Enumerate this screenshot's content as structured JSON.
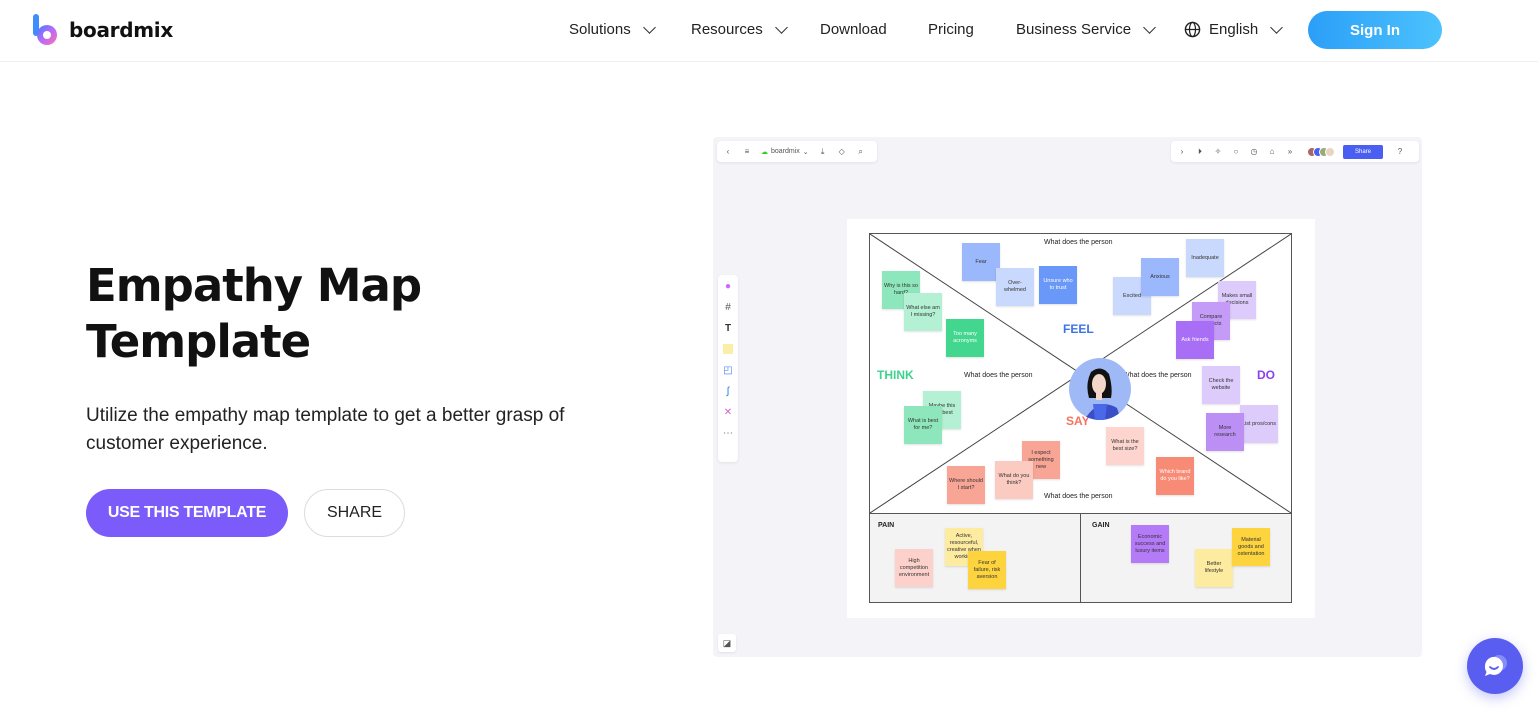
{
  "header": {
    "brand": "boardmix",
    "nav": [
      {
        "label": "Solutions",
        "has_dropdown": true
      },
      {
        "label": "Resources",
        "has_dropdown": true
      },
      {
        "label": "Download",
        "has_dropdown": false
      },
      {
        "label": "Pricing",
        "has_dropdown": false
      },
      {
        "label": "Business Service",
        "has_dropdown": true
      }
    ],
    "language": "English",
    "sign_in": "Sign In"
  },
  "hero": {
    "title_line1": "Empathy Map",
    "title_line2": "Template",
    "description": "Utilize the empathy map template to get a better grasp of customer experience.",
    "primary_button": "USE THIS TEMPLATE",
    "secondary_button": "SHARE",
    "accent_color": "#7b5cfa"
  },
  "preview": {
    "toolbar_left": {
      "board_name": "boardmix"
    },
    "toolbar_right": {
      "share_label": "Share"
    },
    "map": {
      "quadrants": {
        "feel": "FEEL",
        "think": "THINK",
        "do": "DO",
        "say": "SAY"
      },
      "prompts": {
        "top": "What does the person",
        "left": "What does the person",
        "right": "What does the person",
        "bottom": "What does the person"
      },
      "sections": {
        "pain": "PAIN",
        "gain": "GAIN"
      },
      "notes": {
        "feel": [
          "Fear",
          "Over-whelmed",
          "Unsure who to trust",
          "Excited",
          "Anxious",
          "Inadequate"
        ],
        "think": [
          "Why is this so hard?",
          "What else am I missing?",
          "Too many acronyms",
          "Maybe this isn't best",
          "What is best for me?"
        ],
        "do": [
          "Makes small decisions",
          "Compare products",
          "Ask friends",
          "Check the website",
          "List pros/cons",
          "More research"
        ],
        "say": [
          "I expect something new",
          "What do you think?",
          "Where should I start?",
          "What is the best size?",
          "Which brand do you like?"
        ],
        "pain": [
          "High competition environment",
          "Active, resourceful, creative when working",
          "Fear of failure, risk aversion"
        ],
        "gain": [
          "Economic success and luxury items",
          "Better lifestyle",
          "Material goods and ostentation"
        ]
      },
      "colors": {
        "feel": "#3d73e8",
        "think": "#3fd28c",
        "do": "#8b3ff0",
        "say": "#f4735f"
      }
    }
  }
}
